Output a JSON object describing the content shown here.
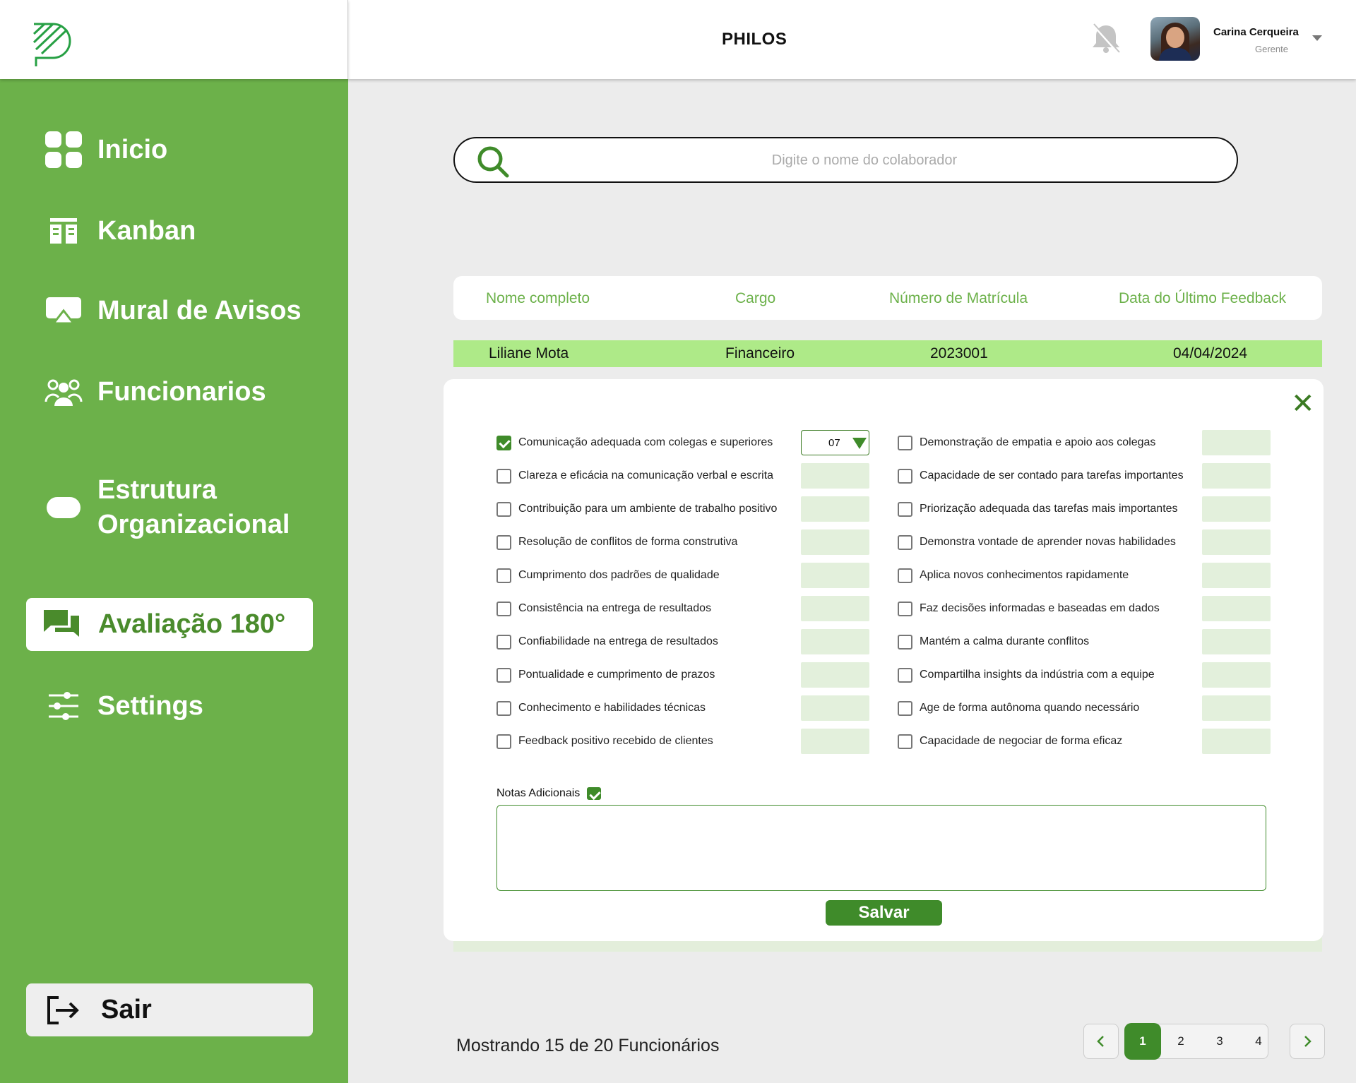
{
  "app": {
    "title": "PHILOS"
  },
  "user": {
    "name": "Carina Cerqueira",
    "role": "Gerente"
  },
  "nav": {
    "items": [
      {
        "label": "Inicio",
        "icon": "grid-icon"
      },
      {
        "label": "Kanban",
        "icon": "kanban-icon"
      },
      {
        "label": "Mural de Avisos",
        "icon": "announcement-icon"
      },
      {
        "label": "Funcionarios",
        "icon": "people-icon"
      },
      {
        "label_line1": "Estrutura",
        "label_line2": "Organizacional",
        "icon": "pill-icon"
      },
      {
        "label": "Avaliação 180°",
        "icon": "chat-icon",
        "active": true
      },
      {
        "label": "Settings",
        "icon": "sliders-icon"
      }
    ],
    "logout": "Sair"
  },
  "search": {
    "placeholder": "Digite o nome do colaborador"
  },
  "table": {
    "headers": [
      "Nome completo",
      "Cargo",
      "Número de Matrícula",
      "Data do Último Feedback"
    ],
    "row": {
      "name": "Liliane Mota",
      "cargo": "Financeiro",
      "matricula": "2023001",
      "data": "04/04/2024"
    }
  },
  "modal": {
    "left_criteria": [
      "Comunicação adequada com colegas e superiores",
      "Clareza e eficácia na comunicação verbal e escrita",
      "Contribuição para um ambiente de trabalho positivo",
      "Resolução de conflitos de forma construtiva",
      "Cumprimento dos padrões de qualidade",
      "Consistência na entrega de resultados",
      "Confiabilidade na entrega de resultados",
      "Pontualidade e cumprimento de prazos",
      "Conhecimento e habilidades técnicas",
      "Feedback positivo recebido de clientes"
    ],
    "right_criteria": [
      "Demonstração de empatia e apoio aos colegas",
      "Capacidade de ser contado para tarefas importantes",
      "Priorização adequada das tarefas mais importantes",
      "Demonstra vontade de aprender novas habilidades",
      "Aplica novos conhecimentos rapidamente",
      "Faz decisões informadas e baseadas em dados",
      "Mantém a calma durante conflitos",
      "Compartilha insights da indústria com a equipe",
      "Age de forma autônoma quando necessário",
      "Capacidade de negociar de forma eficaz"
    ],
    "selected_score": "07",
    "notes_label": "Notas Adicionais",
    "save_label": "Salvar"
  },
  "footer": {
    "showing": "Mostrando 15 de 20 Funcionários",
    "pages": [
      "1",
      "2",
      "3",
      "4"
    ],
    "current_page": "1"
  },
  "colors": {
    "sidebar": "#6cb14a",
    "accent": "#3f8b2a",
    "row_highlight": "#aeea88",
    "header_text": "#6cb14a"
  }
}
